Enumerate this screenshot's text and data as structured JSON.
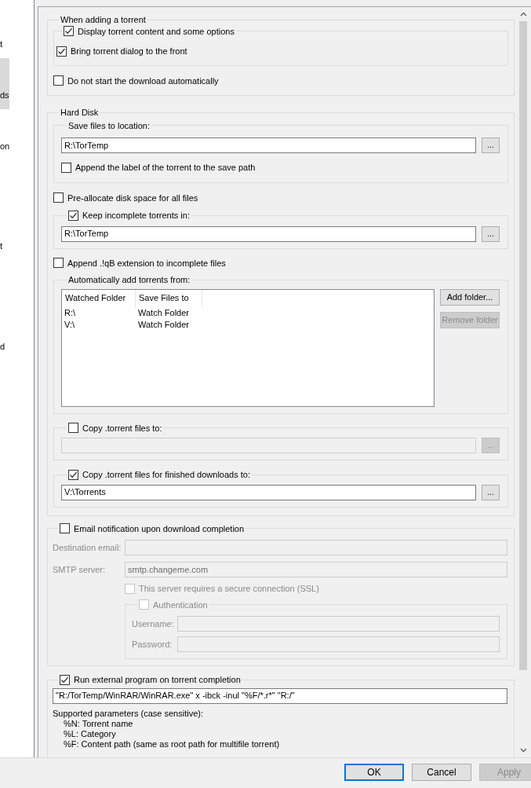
{
  "sidebar": {
    "items": [
      {
        "label": "t",
        "selected": false
      },
      {
        "label": "ds",
        "selected": true
      },
      {
        "label": "on",
        "selected": false
      },
      {
        "label": "t",
        "selected": false
      },
      {
        "label": "d",
        "selected": false
      }
    ]
  },
  "adding": {
    "title": "When adding a torrent",
    "display_content": {
      "label": "Display torrent content and some options",
      "checked": true
    },
    "bring_front": {
      "label": "Bring torrent dialog to the front",
      "checked": true
    },
    "no_start": {
      "label": "Do not start the download automatically",
      "checked": false
    }
  },
  "hard_disk": {
    "title": "Hard Disk",
    "save_location": {
      "title": "Save files to location:",
      "value": "R:\\TorTemp",
      "browse": "...",
      "append_label": {
        "label": "Append the label of the torrent to the save path",
        "checked": false
      }
    },
    "preallocate": {
      "label": "Pre-allocate disk space for all files",
      "checked": false
    },
    "keep_incomplete": {
      "label": "Keep incomplete torrents in:",
      "checked": true,
      "value": "R:\\TorTemp",
      "browse": "..."
    },
    "append_qb": {
      "label": "Append .!qB extension to incomplete files",
      "checked": false
    },
    "watch": {
      "title": "Automatically add torrents from:",
      "columns": [
        "Watched Folder",
        "Save Files to"
      ],
      "rows": [
        [
          "R:\\",
          "Watch Folder"
        ],
        [
          "V:\\",
          "Watch Folder"
        ]
      ],
      "buttons": [
        {
          "label": "Add folder...",
          "disabled": false
        },
        {
          "label": "Remove folder",
          "disabled": true
        }
      ]
    },
    "copy_torrent": {
      "label": "Copy .torrent files to:",
      "checked": false,
      "browse": "..."
    },
    "copy_finished": {
      "label": "Copy .torrent files for finished downloads to:",
      "checked": true,
      "value": "V:\\Torrents",
      "browse": "..."
    }
  },
  "email": {
    "label": "Email notification upon download completion",
    "checked": false,
    "destination_label": "Destination email:",
    "smtp_label": "SMTP server:",
    "smtp_value": "smtp.changeme.com",
    "ssl": {
      "label": "This server requires a secure connection (SSL)",
      "checked": false
    },
    "auth": {
      "label": "Authentication",
      "checked": false,
      "username_label": "Username:",
      "password_label": "Password:"
    }
  },
  "run_program": {
    "label": "Run external program on torrent completion",
    "checked": true,
    "value": "\"R:/TorTemp/WinRAR/WinRAR.exe\" x -ibck -inul \"%F/*.r*\" \"R:/\"",
    "help_title": "Supported parameters (case sensitive):",
    "params": [
      "%N: Torrent name",
      "%L: Category",
      "%F: Content path (same as root path for multifile torrent)"
    ]
  },
  "buttons": [
    {
      "label": "OK",
      "focused": true,
      "disabled": false
    },
    {
      "label": "Cancel",
      "focused": false,
      "disabled": false
    },
    {
      "label": "Apply",
      "focused": false,
      "disabled": true
    }
  ]
}
